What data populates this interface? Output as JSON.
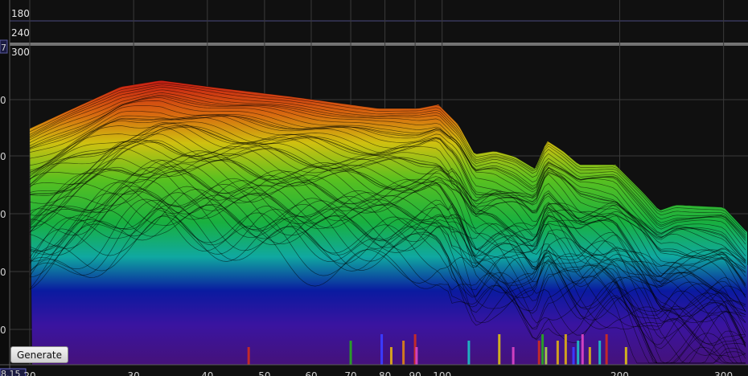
{
  "app": {
    "title": ""
  },
  "controls": {
    "generate_label": "Generate"
  },
  "time_rows": [
    "180",
    "240",
    "300"
  ],
  "y_axis_partial": [
    "0",
    "0",
    "0",
    "0",
    "0"
  ],
  "corner_labels": {
    "top_left": "7",
    "bottom_left": "8.15"
  },
  "x_axis_ticks": [
    {
      "label": "20",
      "f": 20
    },
    {
      "label": "30",
      "f": 30
    },
    {
      "label": "40",
      "f": 40
    },
    {
      "label": "50",
      "f": 50
    },
    {
      "label": "60",
      "f": 60
    },
    {
      "label": "70",
      "f": 70
    },
    {
      "label": "80",
      "f": 80
    },
    {
      "label": "90",
      "f": 90
    },
    {
      "label": "100",
      "f": 100
    },
    {
      "label": "200",
      "f": 200
    },
    {
      "label": "300",
      "f": 300
    }
  ],
  "colors": {
    "background": "#101010",
    "grid": "#3a3a3a",
    "base": "#45127a",
    "spectrum_top": "#c81e14",
    "spectrum_bottom": "#0a1aa0"
  },
  "markers": [
    {
      "f": 47,
      "color": "#c22a2a"
    },
    {
      "f": 70,
      "color": "#2a9a2a"
    },
    {
      "f": 79,
      "color": "#3a3aff"
    },
    {
      "f": 82,
      "color": "#d4a020"
    },
    {
      "f": 86,
      "color": "#d07a20"
    },
    {
      "f": 90,
      "color": "#c22a2a"
    },
    {
      "f": 90.5,
      "color": "#d040c0"
    },
    {
      "f": 111,
      "color": "#20b0c0"
    },
    {
      "f": 125,
      "color": "#d0b020"
    },
    {
      "f": 132,
      "color": "#d040c0"
    },
    {
      "f": 146,
      "color": "#c22a2a"
    },
    {
      "f": 148,
      "color": "#2a9a2a"
    },
    {
      "f": 150,
      "color": "#a0c050"
    },
    {
      "f": 157,
      "color": "#d0a020"
    },
    {
      "f": 162,
      "color": "#d0a020"
    },
    {
      "f": 167,
      "color": "#3a3aff"
    },
    {
      "f": 170,
      "color": "#20b0c0"
    },
    {
      "f": 173,
      "color": "#d040c0"
    },
    {
      "f": 178,
      "color": "#d0a020"
    },
    {
      "f": 185,
      "color": "#20b0c0"
    },
    {
      "f": 190,
      "color": "#c22a2a"
    },
    {
      "f": 205,
      "color": "#d0b020"
    }
  ]
}
